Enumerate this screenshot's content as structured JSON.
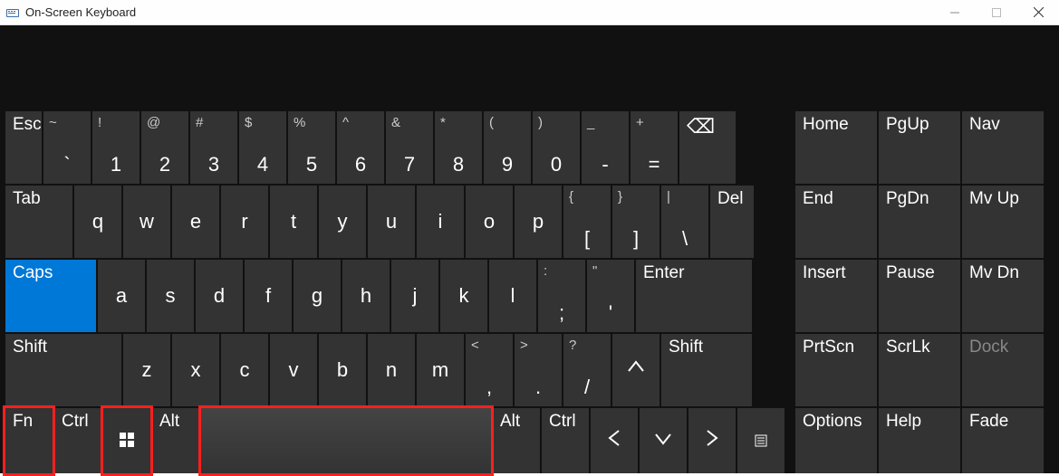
{
  "window": {
    "title": "On-Screen Keyboard"
  },
  "rows": {
    "row1": {
      "esc": "Esc",
      "k1": {
        "u": "~",
        "l": "`"
      },
      "k2": {
        "u": "!",
        "l": "1"
      },
      "k3": {
        "u": "@",
        "l": "2"
      },
      "k4": {
        "u": "#",
        "l": "3"
      },
      "k5": {
        "u": "$",
        "l": "4"
      },
      "k6": {
        "u": "%",
        "l": "5"
      },
      "k7": {
        "u": "^",
        "l": "6"
      },
      "k8": {
        "u": "&",
        "l": "7"
      },
      "k9": {
        "u": "*",
        "l": "8"
      },
      "k10": {
        "u": "(",
        "l": "9"
      },
      "k11": {
        "u": ")",
        "l": "0"
      },
      "k12": {
        "u": "_",
        "l": "-"
      },
      "k13": {
        "u": "+",
        "l": "="
      },
      "bksp": "⌫",
      "home": "Home",
      "pgup": "PgUp",
      "nav": "Nav"
    },
    "row2": {
      "tab": "Tab",
      "q": "q",
      "w": "w",
      "e": "e",
      "r": "r",
      "t": "t",
      "y": "y",
      "u": "u",
      "i": "i",
      "o": "o",
      "p": "p",
      "br1": {
        "u": "{",
        "l": "["
      },
      "br2": {
        "u": "}",
        "l": "]"
      },
      "bs": {
        "u": "|",
        "l": "\\"
      },
      "del": "Del",
      "end": "End",
      "pgdn": "PgDn",
      "mvup": "Mv Up"
    },
    "row3": {
      "caps": "Caps",
      "a": "a",
      "s": "s",
      "d": "d",
      "f": "f",
      "g": "g",
      "h": "h",
      "j": "j",
      "k": "k",
      "l": "l",
      "semi": {
        "u": ":",
        "l": ";"
      },
      "quote": {
        "u": "\"",
        "l": "'"
      },
      "enter": "Enter",
      "insert": "Insert",
      "pause": "Pause",
      "mvdn": "Mv Dn"
    },
    "row4": {
      "shiftL": "Shift",
      "z": "z",
      "x": "x",
      "c": "c",
      "v": "v",
      "b": "b",
      "n": "n",
      "m": "m",
      "comma": {
        "u": "<",
        "l": ","
      },
      "period": {
        "u": ">",
        "l": "."
      },
      "slash": {
        "u": "?",
        "l": "/"
      },
      "up": "∧",
      "shiftR": "Shift",
      "prtscn": "PrtScn",
      "scrlk": "ScrLk",
      "dock": "Dock"
    },
    "row5": {
      "fn": "Fn",
      "ctrlL": "Ctrl",
      "win": "",
      "altL": "Alt",
      "space": "",
      "altR": "Alt",
      "ctrlR": "Ctrl",
      "left": "〈",
      "down": "∨",
      "right": "〉",
      "menu": "",
      "options": "Options",
      "help": "Help",
      "fade": "Fade"
    }
  }
}
